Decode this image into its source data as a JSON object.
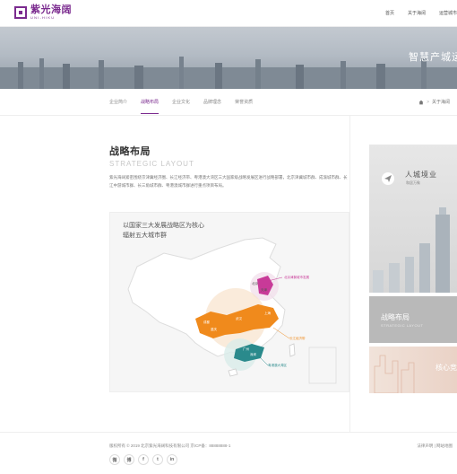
{
  "header": {
    "logo_cn": "紫光海阔",
    "logo_en": "UNI-HIKU",
    "nav": [
      "首页",
      "关于海阔",
      "运营城市"
    ]
  },
  "banner": {
    "text": "智慧产城运"
  },
  "subnav": {
    "items": [
      "企业简介",
      "战略布局",
      "企业文化",
      "品牌理念",
      "荣誉资质"
    ],
    "active_index": 1
  },
  "breadcrumb": {
    "items": [
      "关于海阔"
    ]
  },
  "main": {
    "title_cn": "战略布局",
    "title_en": "STRATEGIC LAYOUT",
    "intro": "紫光海阔紧密围绕京津冀经济圈、长江经济带、粤港澳大湾区三大国家级战略发展区进行战略部署，北京津冀城市群、成渝城市群、长江中游城市群、长三角城市群、粤港澳城市群进行重点项目布局。"
  },
  "map": {
    "title_line1": "以国家三大发展战略区为核心",
    "title_line2": "辐射五大城市群",
    "labels": {
      "beijing": "北京",
      "tianjin": "天津",
      "region1": "北京津冀城市发展",
      "region2": "长江经济带",
      "region3": "粤港澳大湾区",
      "chengdu": "成都",
      "chongqing": "重庆",
      "wuhan": "武汉",
      "shanghai": "上海",
      "guangzhou": "广州",
      "shenzhen": "深圳"
    }
  },
  "side": {
    "card1_title": "人城境业",
    "card1_sub": "和居万象",
    "card2_title": "战略布局",
    "card2_sub": "STRATEGIC LAYOUT",
    "card3_title": "核心竞"
  },
  "footer": {
    "copyright": "版权所有 © 2019 北京紫光海阔科技有限公司  京ICP备：88888888-1",
    "links": "法律声明 | 网站地图",
    "socials": [
      "微",
      "博",
      "f",
      "t",
      "in"
    ]
  },
  "colors": {
    "brand": "#7b2b8f",
    "orange": "#f08a1c",
    "teal": "#2a8a8c",
    "magenta": "#c83a98"
  }
}
